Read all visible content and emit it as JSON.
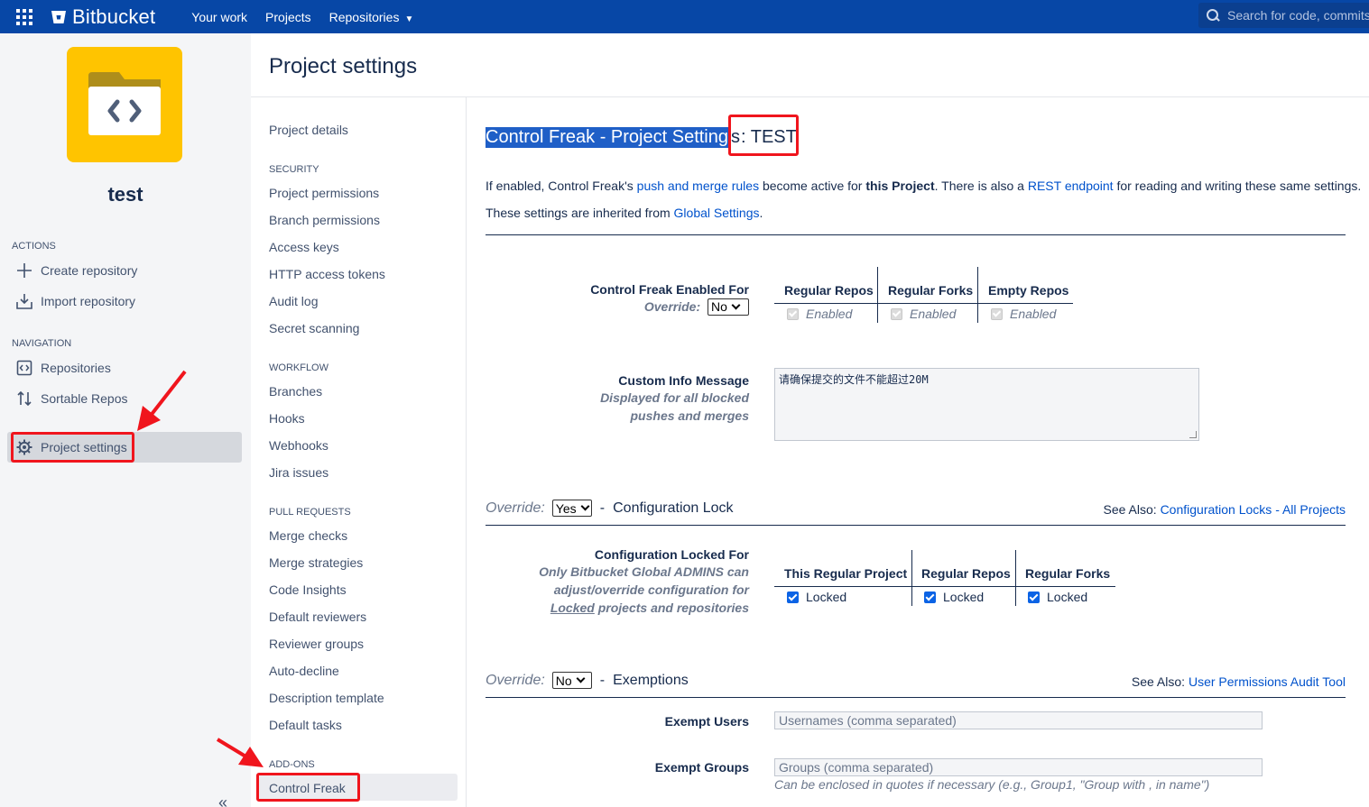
{
  "topbar": {
    "app_name": "Bitbucket",
    "nav": [
      "Your work",
      "Projects",
      "Repositories"
    ],
    "search_placeholder": "Search for code, commits"
  },
  "sidebar": {
    "project_name": "test",
    "actions_heading": "ACTIONS",
    "actions": [
      "Create repository",
      "Import repository"
    ],
    "navigation_heading": "NAVIGATION",
    "navigation": [
      "Repositories",
      "Sortable Repos",
      "Project settings"
    ]
  },
  "page": {
    "title": "Project settings"
  },
  "subnav": {
    "project_details": "Project details",
    "security_heading": "SECURITY",
    "security": [
      "Project permissions",
      "Branch permissions",
      "Access keys",
      "HTTP access tokens",
      "Audit log",
      "Secret scanning"
    ],
    "workflow_heading": "WORKFLOW",
    "workflow": [
      "Branches",
      "Hooks",
      "Webhooks",
      "Jira issues"
    ],
    "pull_requests_heading": "PULL REQUESTS",
    "pull_requests": [
      "Merge checks",
      "Merge strategies",
      "Code Insights",
      "Default reviewers",
      "Reviewer groups",
      "Auto-decline",
      "Description template",
      "Default tasks"
    ],
    "addons_heading": "ADD-ONS",
    "addons": [
      "Control Freak"
    ]
  },
  "content": {
    "heading_highlight": "Control Freak - Project Setting",
    "heading_end": "s",
    "heading_name": ": TEST",
    "intro": {
      "t1": "If enabled, Control Freak's ",
      "link1": "push and merge rules",
      "t2": " become active for ",
      "bold": "this Project",
      "t3": ". There is also a ",
      "link2": "REST endpoint",
      "t4": " for reading and writing these same settings."
    },
    "inherited": {
      "t1": "These settings are inherited from ",
      "link": "Global Settings",
      "t2": "."
    },
    "enabled_for": {
      "label": "Control Freak Enabled For",
      "override_label": "Override:",
      "override_value": "No",
      "columns": [
        "Regular Repos",
        "Regular Forks",
        "Empty Repos"
      ],
      "cell_label": "Enabled"
    },
    "custom_message": {
      "label": "Custom Info Message",
      "sub1": "Displayed for all blocked",
      "sub2": "pushes and merges",
      "value": "请确保提交的文件不能超过20M"
    },
    "config_lock": {
      "override_label": "Override:",
      "override_value": "Yes",
      "dash": "-",
      "title": "Configuration Lock",
      "see_also": "See Also: ",
      "see_also_link": "Configuration Locks - All Projects",
      "label": "Configuration Locked For",
      "sub1": "Only Bitbucket Global ADMINS can",
      "sub2": "adjust/override configuration for",
      "sub3_u": "Locked",
      "sub3": " projects and repositories",
      "columns": [
        "This Regular Project",
        "Regular Repos",
        "Regular Forks"
      ],
      "cell_label": "Locked"
    },
    "exemptions": {
      "override_label": "Override:",
      "override_value": "No",
      "dash": "-",
      "title": "Exemptions",
      "see_also": "See Also: ",
      "see_also_link": "User Permissions Audit Tool",
      "users_label": "Exempt Users",
      "users_placeholder": "Usernames (comma separated)",
      "groups_label": "Exempt Groups",
      "groups_placeholder": "Groups (comma separated)",
      "hint": "Can be enclosed in quotes if necessary (e.g., Group1, \"Group with , in name\")"
    }
  },
  "colors": {
    "topbar": "#0747a6",
    "link": "#0052cc",
    "annotation": "#f0151d",
    "avatar": "#ffc400"
  },
  "icons": [
    "app-switcher-icon",
    "bitbucket-logo-icon",
    "chevron-down-icon",
    "search-icon",
    "plus-icon",
    "import-icon",
    "repository-icon",
    "sort-icon",
    "gear-icon",
    "collapse-icon"
  ]
}
